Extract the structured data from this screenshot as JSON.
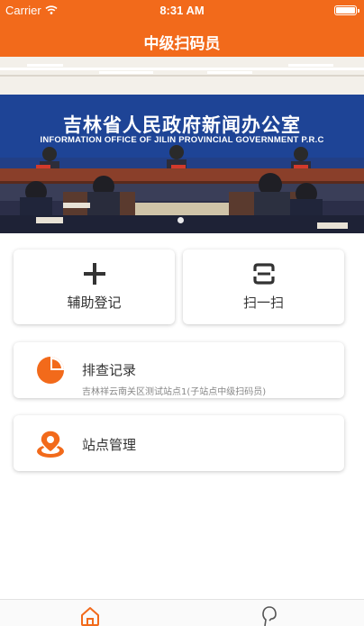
{
  "status_bar": {
    "carrier": "Carrier",
    "time": "8:31 AM"
  },
  "nav": {
    "title": "中级扫码员"
  },
  "banner": {
    "title": "吉林省人民政府新闻办公室",
    "subtitle": "INFORMATION OFFICE OF JILIN PROVINCIAL GOVERNMENT P.R.C"
  },
  "tiles": [
    {
      "label": "辅助登记",
      "icon": "plus-icon"
    },
    {
      "label": "扫一扫",
      "icon": "scan-icon"
    }
  ],
  "rows": [
    {
      "title": "排查记录",
      "subtitle": "吉林祥云南关区测试站点1(子站点中级扫码员)",
      "icon": "pie-chart-icon"
    },
    {
      "title": "站点管理",
      "icon": "location-pin-icon"
    }
  ],
  "tabs": [
    {
      "icon": "home-icon"
    },
    {
      "icon": "profile-icon"
    }
  ],
  "colors": {
    "accent": "#f26a1b",
    "banner_blue": "#1c3e8a",
    "icon_dark": "#333333"
  }
}
